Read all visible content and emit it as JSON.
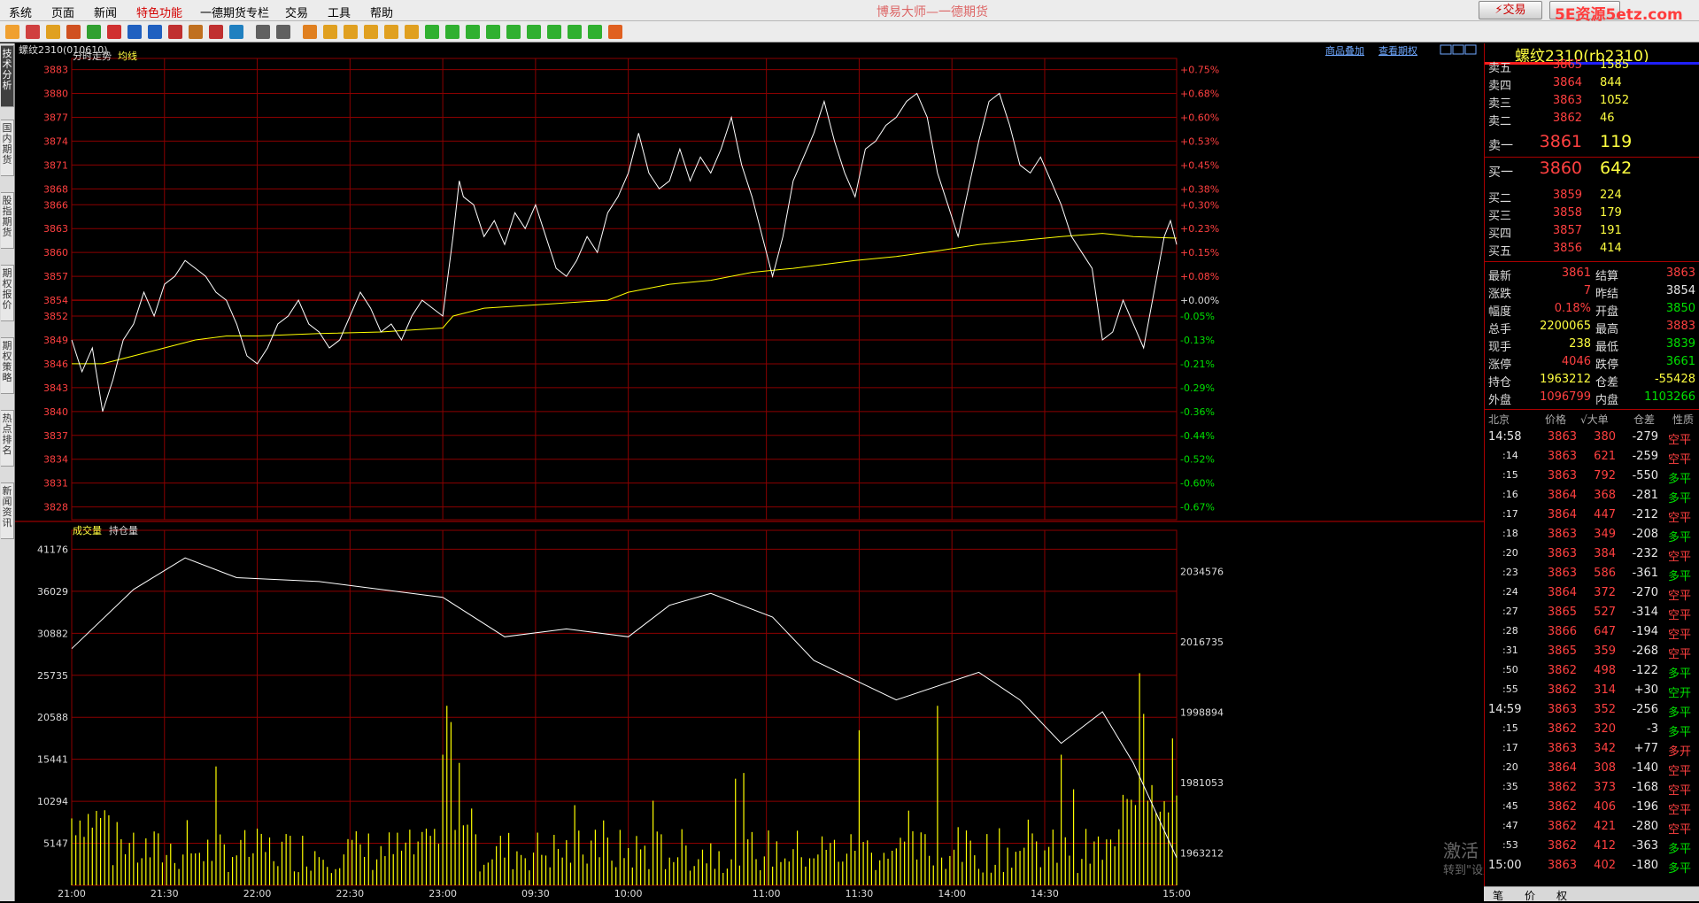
{
  "menu": {
    "items": [
      "系统",
      "页面",
      "新闻",
      "特色功能",
      "一德期货专栏",
      "交易",
      "工具",
      "帮助"
    ],
    "highlight_index": 3
  },
  "app_title": "博易大师—一德期货",
  "trade_button": "⚡交易",
  "watermark": "5E资源5etz.com",
  "sidebar_tabs": [
    "技术分析",
    "国内期货",
    "股指期货",
    "期权报价",
    "期权策略",
    "热点排名",
    "新闻资讯"
  ],
  "chart_header": {
    "contract": "螺纹2310(010610)",
    "links": [
      "商品叠加",
      "查看期权"
    ]
  },
  "price_panel": {
    "label": "分时走势",
    "ma_label": "均线"
  },
  "volume_panel": {
    "label": "成交量",
    "oi_label": "持仓量"
  },
  "chart_data": {
    "type": "line",
    "price_axis": {
      "ticks": [
        3883,
        3880,
        3877,
        3874,
        3871,
        3868,
        3866,
        3863,
        3860,
        3857,
        3854,
        3852,
        3849,
        3846,
        3843,
        3840,
        3837,
        3834,
        3831,
        3828
      ],
      "range": [
        3826.4,
        3884.4
      ],
      "prev_settle": 3854
    },
    "pct_ticks": [
      "+0.75%",
      "+0.68%",
      "+0.60%",
      "+0.53%",
      "+0.45%",
      "+0.38%",
      "+0.30%",
      "+0.23%",
      "+0.15%",
      "+0.08%",
      "+0.00%",
      "-0.05%",
      "-0.13%",
      "-0.21%",
      "-0.29%",
      "-0.36%",
      "-0.44%",
      "-0.52%",
      "-0.60%",
      "-0.67%"
    ],
    "time_ticks": [
      "21:00",
      "21:30",
      "22:00",
      "22:30",
      "23:00",
      "09:30",
      "10:00",
      "11:00",
      "11:30",
      "14:00",
      "14:30",
      "15:00"
    ],
    "price_series": [
      [
        0,
        3849
      ],
      [
        5,
        3845
      ],
      [
        10,
        3848
      ],
      [
        15,
        3840
      ],
      [
        20,
        3844
      ],
      [
        25,
        3849
      ],
      [
        30,
        3851
      ],
      [
        35,
        3855
      ],
      [
        40,
        3852
      ],
      [
        45,
        3856
      ],
      [
        50,
        3857
      ],
      [
        55,
        3859
      ],
      [
        60,
        3858
      ],
      [
        65,
        3857
      ],
      [
        70,
        3855
      ],
      [
        75,
        3854
      ],
      [
        80,
        3851
      ],
      [
        85,
        3847
      ],
      [
        90,
        3846
      ],
      [
        95,
        3848
      ],
      [
        100,
        3851
      ],
      [
        105,
        3852
      ],
      [
        110,
        3854
      ],
      [
        115,
        3851
      ],
      [
        120,
        3850
      ],
      [
        125,
        3848
      ],
      [
        130,
        3849
      ],
      [
        135,
        3852
      ],
      [
        140,
        3855
      ],
      [
        145,
        3853
      ],
      [
        150,
        3850
      ],
      [
        155,
        3851
      ],
      [
        160,
        3849
      ],
      [
        165,
        3852
      ],
      [
        170,
        3854
      ],
      [
        175,
        3853
      ],
      [
        180,
        3852
      ],
      [
        185,
        3862
      ],
      [
        188,
        3869
      ],
      [
        190,
        3867
      ],
      [
        195,
        3866
      ],
      [
        200,
        3862
      ],
      [
        205,
        3864
      ],
      [
        210,
        3861
      ],
      [
        215,
        3865
      ],
      [
        220,
        3863
      ],
      [
        225,
        3866
      ],
      [
        230,
        3862
      ],
      [
        235,
        3858
      ],
      [
        240,
        3857
      ],
      [
        245,
        3859
      ],
      [
        250,
        3862
      ],
      [
        255,
        3860
      ],
      [
        260,
        3865
      ],
      [
        265,
        3867
      ],
      [
        270,
        3870
      ],
      [
        275,
        3875
      ],
      [
        280,
        3870
      ],
      [
        285,
        3868
      ],
      [
        290,
        3869
      ],
      [
        295,
        3873
      ],
      [
        300,
        3869
      ],
      [
        305,
        3872
      ],
      [
        310,
        3870
      ],
      [
        315,
        3873
      ],
      [
        320,
        3877
      ],
      [
        325,
        3871
      ],
      [
        330,
        3867
      ],
      [
        335,
        3862
      ],
      [
        340,
        3857
      ],
      [
        345,
        3862
      ],
      [
        350,
        3869
      ],
      [
        355,
        3872
      ],
      [
        360,
        3875
      ],
      [
        365,
        3879
      ],
      [
        370,
        3874
      ],
      [
        375,
        3870
      ],
      [
        380,
        3867
      ],
      [
        385,
        3873
      ],
      [
        390,
        3874
      ],
      [
        395,
        3876
      ],
      [
        400,
        3877
      ],
      [
        405,
        3879
      ],
      [
        410,
        3880
      ],
      [
        415,
        3877
      ],
      [
        420,
        3870
      ],
      [
        425,
        3866
      ],
      [
        430,
        3862
      ],
      [
        435,
        3868
      ],
      [
        440,
        3874
      ],
      [
        445,
        3879
      ],
      [
        450,
        3880
      ],
      [
        455,
        3876
      ],
      [
        460,
        3871
      ],
      [
        465,
        3870
      ],
      [
        470,
        3872
      ],
      [
        475,
        3869
      ],
      [
        480,
        3866
      ],
      [
        485,
        3862
      ],
      [
        490,
        3860
      ],
      [
        495,
        3858
      ],
      [
        500,
        3849
      ],
      [
        505,
        3850
      ],
      [
        510,
        3854
      ],
      [
        515,
        3851
      ],
      [
        520,
        3848
      ],
      [
        525,
        3855
      ],
      [
        530,
        3862
      ],
      [
        533,
        3864
      ],
      [
        536,
        3861
      ]
    ],
    "avg_series": [
      [
        0,
        3846
      ],
      [
        15,
        3846
      ],
      [
        30,
        3847
      ],
      [
        45,
        3848
      ],
      [
        60,
        3849
      ],
      [
        75,
        3849.5
      ],
      [
        90,
        3849.5
      ],
      [
        120,
        3849.8
      ],
      [
        150,
        3850
      ],
      [
        180,
        3850.5
      ],
      [
        185,
        3852
      ],
      [
        200,
        3853
      ],
      [
        230,
        3853.5
      ],
      [
        260,
        3854
      ],
      [
        270,
        3855
      ],
      [
        290,
        3856
      ],
      [
        310,
        3856.5
      ],
      [
        330,
        3857.5
      ],
      [
        350,
        3858
      ],
      [
        380,
        3859
      ],
      [
        400,
        3859.5
      ],
      [
        420,
        3860.2
      ],
      [
        440,
        3861
      ],
      [
        460,
        3861.5
      ],
      [
        480,
        3862
      ],
      [
        500,
        3862.4
      ],
      [
        515,
        3862
      ],
      [
        536,
        3861.8
      ]
    ],
    "volume_axis": {
      "ticks": [
        41176,
        36029,
        30882,
        25735,
        20588,
        15441,
        10294,
        5147
      ],
      "max": 43500
    },
    "oi_axis": {
      "ticks": [
        2034576,
        2016735,
        1998894,
        1981053,
        1963212
      ],
      "range": [
        1955000,
        2045000
      ]
    },
    "oi_series": [
      [
        0,
        2015000
      ],
      [
        30,
        2030000
      ],
      [
        55,
        2038000
      ],
      [
        80,
        2033000
      ],
      [
        120,
        2032000
      ],
      [
        180,
        2028000
      ],
      [
        210,
        2018000
      ],
      [
        240,
        2020000
      ],
      [
        270,
        2018000
      ],
      [
        290,
        2026000
      ],
      [
        310,
        2029000
      ],
      [
        340,
        2023000
      ],
      [
        360,
        2012000
      ],
      [
        400,
        2002000
      ],
      [
        440,
        2009000
      ],
      [
        460,
        2002000
      ],
      [
        480,
        1991000
      ],
      [
        500,
        1999000
      ],
      [
        515,
        1986000
      ],
      [
        536,
        1962000
      ]
    ]
  },
  "quote": {
    "title": "螺纹2310(rb2310)",
    "asks": [
      {
        "label": "卖五",
        "price": "3865",
        "vol": "1585"
      },
      {
        "label": "卖四",
        "price": "3864",
        "vol": "844"
      },
      {
        "label": "卖三",
        "price": "3863",
        "vol": "1052"
      },
      {
        "label": "卖二",
        "price": "3862",
        "vol": "46"
      },
      {
        "label": "卖一",
        "price": "3861",
        "vol": "119"
      }
    ],
    "bids": [
      {
        "label": "买一",
        "price": "3860",
        "vol": "642"
      },
      {
        "label": "买二",
        "price": "3859",
        "vol": "224"
      },
      {
        "label": "买三",
        "price": "3858",
        "vol": "179"
      },
      {
        "label": "买四",
        "price": "3857",
        "vol": "191"
      },
      {
        "label": "买五",
        "price": "3856",
        "vol": "414"
      }
    ],
    "stats": [
      {
        "l1": "最新",
        "v1": "3861",
        "c1": "red",
        "l2": "结算",
        "v2": "3863",
        "c2": "red"
      },
      {
        "l1": "涨跌",
        "v1": "7",
        "c1": "red",
        "l2": "昨结",
        "v2": "3854",
        "c2": "wht"
      },
      {
        "l1": "幅度",
        "v1": "0.18%",
        "c1": "red",
        "l2": "开盘",
        "v2": "3850",
        "c2": "grn"
      },
      {
        "l1": "总手",
        "v1": "2200065",
        "c1": "yel",
        "l2": "最高",
        "v2": "3883",
        "c2": "red"
      },
      {
        "l1": "现手",
        "v1": "238",
        "c1": "yel",
        "l2": "最低",
        "v2": "3839",
        "c2": "grn"
      },
      {
        "l1": "涨停",
        "v1": "4046",
        "c1": "red",
        "l2": "跌停",
        "v2": "3661",
        "c2": "grn"
      },
      {
        "l1": "持仓",
        "v1": "1963212",
        "c1": "yel",
        "l2": "仓差",
        "v2": "-55428",
        "c2": "yel"
      },
      {
        "l1": "外盘",
        "v1": "1096799",
        "c1": "red",
        "l2": "内盘",
        "v2": "1103266",
        "c2": "grn"
      }
    ],
    "tick_header": {
      "h0": "北京",
      "h1": "价格",
      "h2": "√大单",
      "h3": "仓差",
      "h4": "性质"
    },
    "ticks": [
      {
        "t": "14:58",
        "p": "3863",
        "v": "380",
        "d": "-279",
        "n": "空平",
        "nc": "red"
      },
      {
        "t": ":14",
        "p": "3863",
        "v": "621",
        "d": "-259",
        "n": "空平",
        "nc": "red"
      },
      {
        "t": ":15",
        "p": "3863",
        "v": "792",
        "d": "-550",
        "n": "多平",
        "nc": "grn"
      },
      {
        "t": ":16",
        "p": "3864",
        "v": "368",
        "d": "-281",
        "n": "多平",
        "nc": "grn"
      },
      {
        "t": ":17",
        "p": "3864",
        "v": "447",
        "d": "-212",
        "n": "空平",
        "nc": "red"
      },
      {
        "t": ":18",
        "p": "3863",
        "v": "349",
        "d": "-208",
        "n": "多平",
        "nc": "grn"
      },
      {
        "t": ":20",
        "p": "3863",
        "v": "384",
        "d": "-232",
        "n": "空平",
        "nc": "red"
      },
      {
        "t": ":23",
        "p": "3863",
        "v": "586",
        "d": "-361",
        "n": "多平",
        "nc": "grn"
      },
      {
        "t": ":24",
        "p": "3864",
        "v": "372",
        "d": "-270",
        "n": "空平",
        "nc": "red"
      },
      {
        "t": ":27",
        "p": "3865",
        "v": "527",
        "d": "-314",
        "n": "空平",
        "nc": "red"
      },
      {
        "t": ":28",
        "p": "3866",
        "v": "647",
        "d": "-194",
        "n": "空平",
        "nc": "red"
      },
      {
        "t": ":31",
        "p": "3865",
        "v": "359",
        "d": "-268",
        "n": "空平",
        "nc": "red"
      },
      {
        "t": ":50",
        "p": "3862",
        "v": "498",
        "d": "-122",
        "n": "多平",
        "nc": "grn"
      },
      {
        "t": ":55",
        "p": "3862",
        "v": "314",
        "d": "+30",
        "n": "空开",
        "nc": "grn"
      },
      {
        "t": "14:59",
        "p": "3863",
        "v": "352",
        "d": "-256",
        "n": "多平",
        "nc": "grn"
      },
      {
        "t": ":15",
        "p": "3862",
        "v": "320",
        "d": "-3",
        "n": "多平",
        "nc": "grn"
      },
      {
        "t": ":17",
        "p": "3863",
        "v": "342",
        "d": "+77",
        "n": "多开",
        "nc": "red"
      },
      {
        "t": ":20",
        "p": "3864",
        "v": "308",
        "d": "-140",
        "n": "空平",
        "nc": "red"
      },
      {
        "t": ":35",
        "p": "3862",
        "v": "373",
        "d": "-168",
        "n": "空平",
        "nc": "red"
      },
      {
        "t": ":45",
        "p": "3862",
        "v": "406",
        "d": "-196",
        "n": "空平",
        "nc": "red"
      },
      {
        "t": ":47",
        "p": "3862",
        "v": "421",
        "d": "-280",
        "n": "空平",
        "nc": "red"
      },
      {
        "t": ":53",
        "p": "3862",
        "v": "412",
        "d": "-363",
        "n": "多平",
        "nc": "grn"
      },
      {
        "t": "15:00",
        "p": "3863",
        "v": "402",
        "d": "-180",
        "n": "多平",
        "nc": "grn"
      }
    ],
    "bottom_tabs": [
      "笔",
      "价",
      "权"
    ]
  },
  "windows_watermark": {
    "line1": "激活 Windows",
    "line2": "转到\"设置\"以激活 Windows。"
  },
  "colors": {
    "grid": "#8b0000",
    "price_line": "#ffffff",
    "avg_line": "#ffff00",
    "volume_bar": "#ffff00",
    "up": "#ff4040",
    "down": "#00e000"
  }
}
